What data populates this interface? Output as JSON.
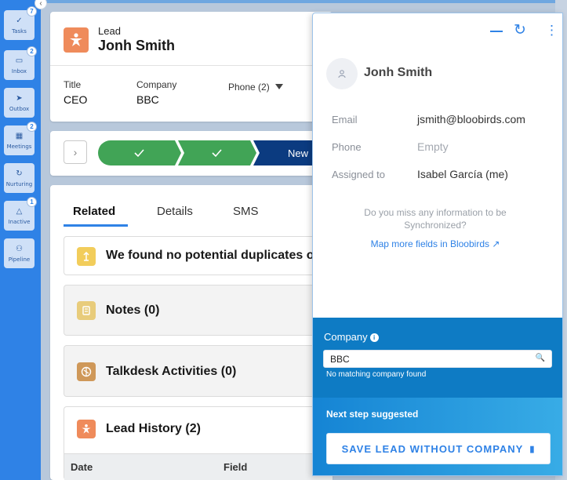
{
  "rail": {
    "items": [
      {
        "label": "Tasks",
        "icon": "✓",
        "badge": "7"
      },
      {
        "label": "Inbox",
        "icon": "▭",
        "badge": "2"
      },
      {
        "label": "Outbox",
        "icon": "➤",
        "badge": ""
      },
      {
        "label": "Meetings",
        "icon": "▦",
        "badge": "2"
      },
      {
        "label": "Nurturing",
        "icon": "↻",
        "badge": ""
      },
      {
        "label": "Inactive",
        "icon": "△",
        "badge": "1"
      },
      {
        "label": "Pipeline",
        "icon": "⚇",
        "badge": ""
      }
    ]
  },
  "lead": {
    "type": "Lead",
    "name": "Jonh Smith",
    "fields": [
      {
        "label": "Title",
        "value": "CEO"
      },
      {
        "label": "Company",
        "value": "BBC"
      }
    ],
    "phone_label": "Phone (2)"
  },
  "path": {
    "current_stage": "New"
  },
  "related": {
    "tabs": [
      "Related",
      "Details",
      "SMS"
    ],
    "duplicates_text": "We found no potential duplicates o",
    "notes_title": "Notes (0)",
    "talkdesk_title": "Talkdesk Activities (0)",
    "history_title": "Lead History (2)",
    "history_columns": [
      "Date",
      "Field"
    ]
  },
  "panel": {
    "name": "Jonh Smith",
    "fields": [
      {
        "label": "Email",
        "value": "jsmith@bloobirds.com",
        "empty": false
      },
      {
        "label": "Phone",
        "value": "Empty",
        "empty": true
      },
      {
        "label": "Assigned to",
        "value": "Isabel García (me)",
        "empty": false
      }
    ],
    "question_line1": "Do you miss any information to be",
    "question_line2": "Synchronized?",
    "map_link": "Map more fields in Bloobirds",
    "company": {
      "label": "Company",
      "value": "BBC",
      "no_match": "No matching company found"
    },
    "next_step": {
      "label": "Next step suggested",
      "button": "SAVE LEAD WITHOUT COMPANY"
    }
  },
  "colors": {
    "accent": "#2f82e6",
    "path_done": "#41a456",
    "path_current": "#0b3b80",
    "lead_icon": "#ef8b5b",
    "company_bg": "#0e7bc4"
  }
}
